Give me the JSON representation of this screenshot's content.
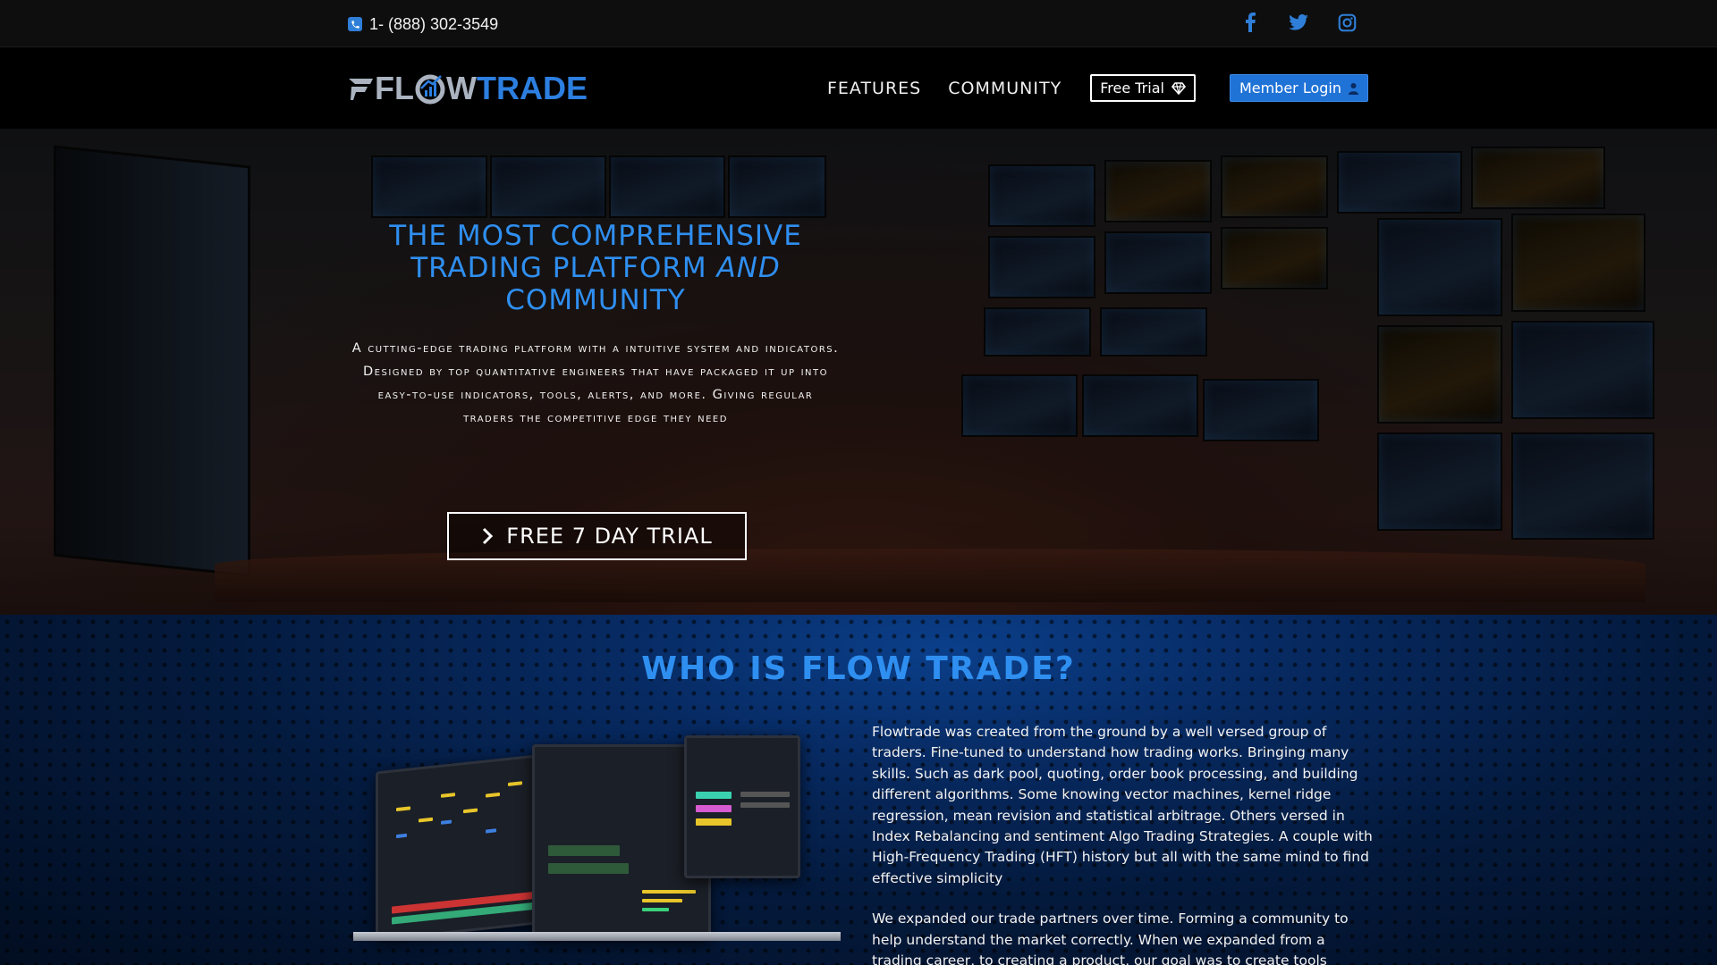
{
  "topbar": {
    "phone": "1- (888) 302-3549",
    "socials": [
      "facebook-icon",
      "twitter-icon",
      "instagram-icon"
    ]
  },
  "logo": {
    "part1": "FL",
    "part2": "W",
    "part3": "TRADE"
  },
  "nav": {
    "features": "FEATURES",
    "community": "COMMUNITY",
    "free_trial": "Free Trial",
    "member_login": "Member Login"
  },
  "hero": {
    "title_line1": "THE MOST COMPREHENSIVE",
    "title_line2a": "TRADING PLATFORM ",
    "title_line2b": "AND",
    "title_line3": "COMMUNITY",
    "subtitle": "A cutting-edge trading platform with a intuitive system and indicators. Designed by top quantitative engineers that  have packaged it up into easy-to-use indicators, tools, alerts, and more. Giving regular traders the competitive edge they need",
    "cta": "FREE 7 DAY TRIAL"
  },
  "about": {
    "title": "WHO IS FLOW TRADE?",
    "para1": "Flowtrade was created from the ground by a well versed group of traders. Fine-tuned to understand how trading works.  Bringing many skills. Such as dark pool, quoting, order book processing, and building different algorithms.  Some knowing vector machines, kernel ridge regression, mean revision and statistical arbitrage. Others versed in Index Rebalancing and sentiment Algo Trading Strategies. A couple with High-Frequency Trading (HFT) history but all with the same mind to find effective simplicity",
    "para2": "We expanded our trade partners over time. Forming a community to help understand the market correctly.  When we expanded from a trading career, to creating a product, our goal was to create tools anyone can use."
  },
  "colors": {
    "accent": "#2f8ff0",
    "login_bg": "#1f72d6",
    "topbar_bg": "#0e0e0f"
  }
}
